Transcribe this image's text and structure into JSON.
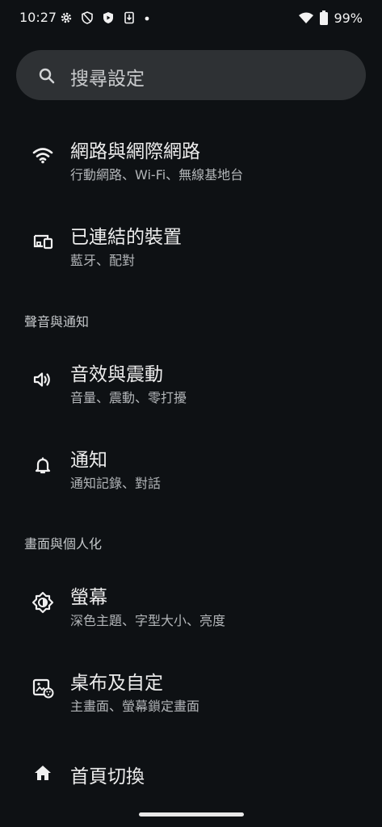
{
  "status_bar": {
    "time": "10:27",
    "battery": "99%",
    "icons_left": [
      "gear-icon",
      "shield-icon",
      "play-shield-icon",
      "download-icon",
      "dot-icon"
    ],
    "icons_right": [
      "wifi-icon",
      "battery-icon"
    ]
  },
  "search": {
    "placeholder": "搜尋設定"
  },
  "items": [
    {
      "title": "網路與網際網路",
      "subtitle": "行動網路、Wi-Fi、無線基地台",
      "icon": "wifi-icon"
    },
    {
      "title": "已連結的裝置",
      "subtitle": "藍牙、配對",
      "icon": "devices-icon"
    },
    {
      "title": "音效與震動",
      "subtitle": "音量、震動、零打擾",
      "icon": "volume-icon"
    },
    {
      "title": "通知",
      "subtitle": "通知記錄、對話",
      "icon": "bell-icon"
    },
    {
      "title": "螢幕",
      "subtitle": "深色主題、字型大小、亮度",
      "icon": "brightness-icon"
    },
    {
      "title": "桌布及自定",
      "subtitle": "主畫面、螢幕鎖定畫面",
      "icon": "wallpaper-icon"
    },
    {
      "title": "首頁切換",
      "icon": "home-icon"
    }
  ],
  "sections": [
    {
      "label": "聲音與通知"
    },
    {
      "label": "畫面與個人化"
    }
  ],
  "theme": {
    "background": "#0e1114",
    "search_background": "#2e3134",
    "text_primary": "#ececec",
    "text_secondary": "#b2b5b8"
  }
}
